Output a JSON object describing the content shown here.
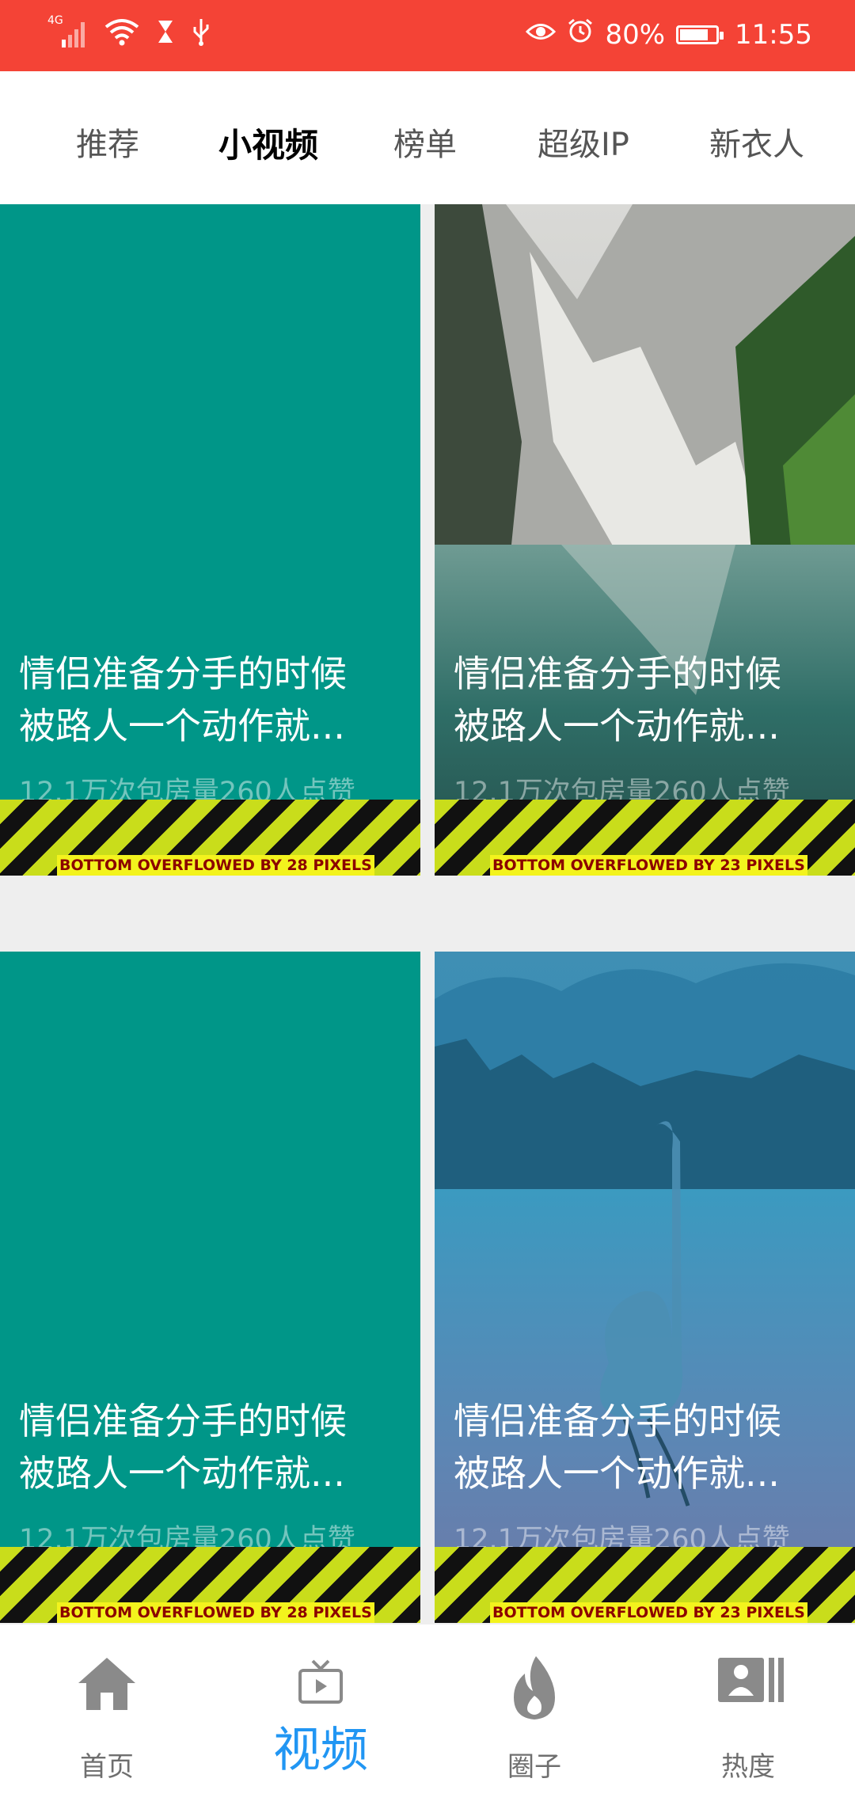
{
  "status_bar": {
    "network": "4G",
    "battery": "80%",
    "battery_level": 0.8,
    "time": "11:55",
    "bg_color": "#f44336"
  },
  "tabs": [
    {
      "label": "推荐",
      "active": false
    },
    {
      "label": "小视频",
      "active": true
    },
    {
      "label": "榜单",
      "active": false
    },
    {
      "label": "超级IP",
      "active": false
    },
    {
      "label": "新衣人",
      "active": false
    }
  ],
  "cards": [
    {
      "title": "情侣准备分手的时候\n被路人一个动作就...",
      "stats": "12.1万次包房量260人点赞",
      "overflow_text": "BOTTOM OVERFLOWED BY 28 PIXELS",
      "background": "teal"
    },
    {
      "title": "情侣准备分手的时候\n被路人一个动作就...",
      "stats": "12.1万次包房量260人点赞",
      "overflow_text": "BOTTOM OVERFLOWED BY 23 PIXELS",
      "background": "mountain-lake-image"
    },
    {
      "title": "情侣准备分手的时候\n被路人一个动作就...",
      "stats": "12.1万次包房量260人点赞",
      "overflow_text": "BOTTOM OVERFLOWED BY 28 PIXELS",
      "background": "teal"
    },
    {
      "title": "情侣准备分手的时候\n被路人一个动作就...",
      "stats": "12.1万次包房量260人点赞",
      "overflow_text": "BOTTOM OVERFLOWED BY 23 PIXELS",
      "background": "swan-lake-image"
    }
  ],
  "bottom_nav": [
    {
      "label": "首页",
      "icon": "home-icon",
      "active": false
    },
    {
      "label": "视频",
      "icon": "tv-icon",
      "active": true
    },
    {
      "label": "圈子",
      "icon": "flame-icon",
      "active": false
    },
    {
      "label": "热度",
      "icon": "profile-card-icon",
      "active": false
    }
  ],
  "colors": {
    "accent": "#2196f3",
    "card_teal": "#009688",
    "overflow_stripe_yellow": "#c9dd1b",
    "overflow_label_text": "#8b0000"
  }
}
